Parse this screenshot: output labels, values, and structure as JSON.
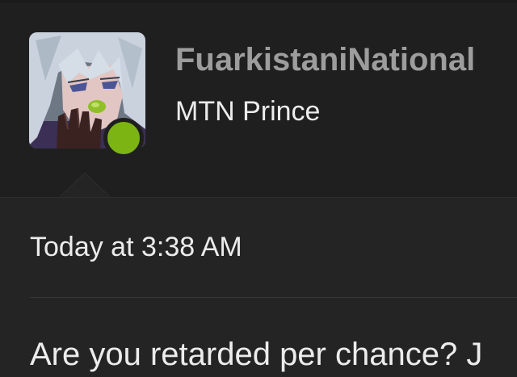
{
  "post": {
    "author": {
      "username": "FuarkistaniNational",
      "title": "MTN Prince",
      "avatar_icon": "anime-character-avatar",
      "online": true,
      "online_color": "#7bb413"
    },
    "timestamp": "Today at 3:38 AM",
    "message": "Are you retarded per chance? J"
  }
}
